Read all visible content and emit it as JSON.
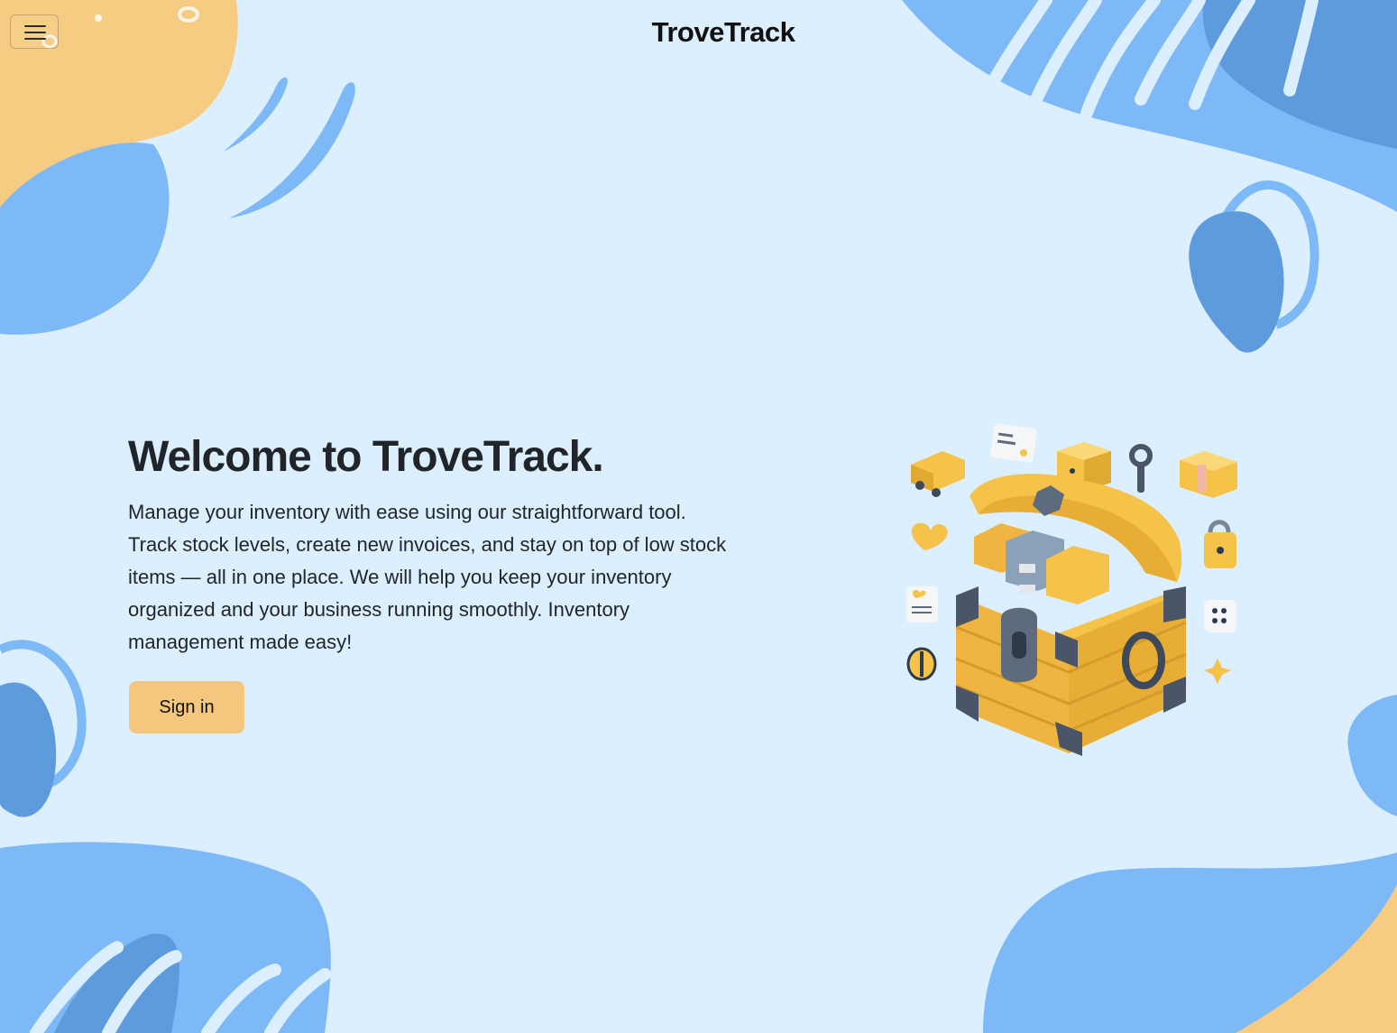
{
  "header": {
    "brand": "TroveTrack",
    "menu_icon": "hamburger-icon"
  },
  "hero": {
    "title": "Welcome to TroveTrack.",
    "description": "Manage your inventory with ease using our straightforward tool. Track stock levels, create new invoices, and stay on top of low stock items — all in one place. We will help you keep your inventory organized and your business running smoothly. Inventory management made easy!",
    "signin_label": "Sign in",
    "illustration": "treasure-chest-illustration"
  },
  "colors": {
    "background": "#dcefff",
    "blob_blue": "#7db8f7",
    "blob_blue_dark": "#5e9bdc",
    "blob_orange": "#f5cc82",
    "button": "#f5c77e",
    "text": "#212529"
  }
}
